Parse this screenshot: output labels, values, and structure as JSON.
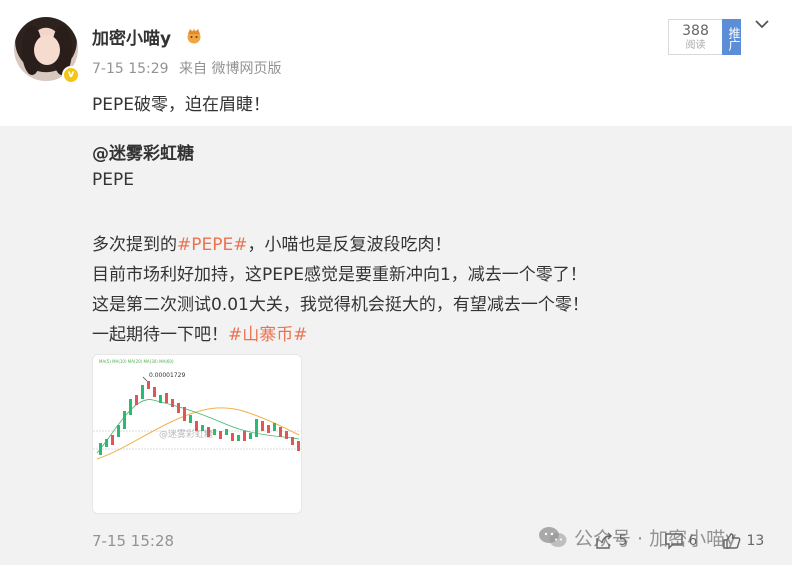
{
  "post": {
    "author": "加密小喵y",
    "time": "7-15 15:29",
    "source": "来自 微博网页版",
    "text": "PEPE破零，迫在眉睫！",
    "read_count": "388",
    "read_label": "阅读",
    "promote_label": "推广"
  },
  "repost": {
    "author": "@迷雾彩虹糖",
    "line1": "PEPE",
    "line2_pre": "多次提到的",
    "line2_tag": "#PEPE#",
    "line2_post": "，小喵也是反复波段吃肉！",
    "line3": "目前市场利好加持，这PEPE感觉是要重新冲向1，减去一个零了！",
    "line4": "这是第二次测试0.01大关，我觉得机会挺大的，有望减去一个零！",
    "line5_pre": "一起期待一下吧！",
    "line5_tag": "#山寨币#",
    "time": "7-15 15:28",
    "chart_label": "0.00001729",
    "chart_watermark": "@迷雾彩虹糖",
    "share_count": "5",
    "comment_count": "6",
    "like_count": "13"
  },
  "watermark": {
    "text": "公众号 · 加密小喵y"
  },
  "colors": {
    "hashtag": "#eb7350",
    "promote": "#5c8ed8",
    "repost_bg": "#f2f2f2",
    "meta_gray": "#939393"
  }
}
